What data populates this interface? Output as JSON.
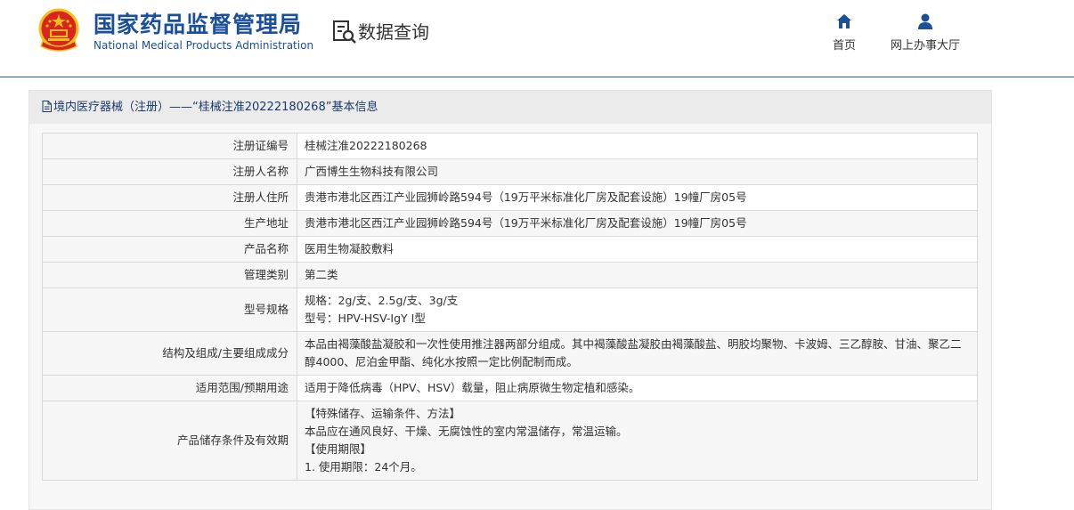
{
  "header": {
    "site_name_cn": "国家药品监督管理局",
    "site_name_en": "National Medical Products Administration",
    "section_title": "数据查询",
    "nav": [
      {
        "label": "首页",
        "icon": "home-icon"
      },
      {
        "label": "网上办事大厅",
        "icon": "user-icon"
      }
    ]
  },
  "panel": {
    "title": "境内医疗器械（注册）——“桂械注准20222180268”基本信息"
  },
  "rows": [
    {
      "label": "注册证编号",
      "lines": [
        "桂械注准20222180268"
      ]
    },
    {
      "label": "注册人名称",
      "lines": [
        "广西博生生物科技有限公司"
      ]
    },
    {
      "label": "注册人住所",
      "lines": [
        "贵港市港北区西江产业园狮岭路594号（19万平米标准化厂房及配套设施）19幢厂房05号"
      ]
    },
    {
      "label": "生产地址",
      "lines": [
        "贵港市港北区西江产业园狮岭路594号（19万平米标准化厂房及配套设施）19幢厂房05号"
      ]
    },
    {
      "label": "产品名称",
      "lines": [
        "医用生物凝胶敷料"
      ]
    },
    {
      "label": "管理类别",
      "lines": [
        "第二类"
      ]
    },
    {
      "label": "型号规格",
      "lines": [
        "规格：2g/支、2.5g/支、3g/支",
        "型号：HPV-HSV-IgY Ⅰ型"
      ]
    },
    {
      "label": "结构及组成/主要组成成分",
      "lines": [
        "本品由褐藻酸盐凝胶和一次性使用推注器两部分组成。其中褐藻酸盐凝胶由褐藻酸盐、明胶均聚物、卡波姆、三乙醇胺、甘油、聚乙二醇4000、尼泊金甲酯、纯化水按照一定比例配制而成。"
      ]
    },
    {
      "label": "适用范围/预期用途",
      "lines": [
        "适用于降低病毒（HPV、HSV）载量，阻止病原微生物定植和感染。"
      ]
    },
    {
      "label": "产品储存条件及有效期",
      "lines": [
        "【特殊储存、运输条件、方法】",
        "本品应在通风良好、干燥、无腐蚀性的室内常温储存，常温运输。",
        "【使用期限】",
        "1. 使用期限：24个月。"
      ]
    }
  ]
}
